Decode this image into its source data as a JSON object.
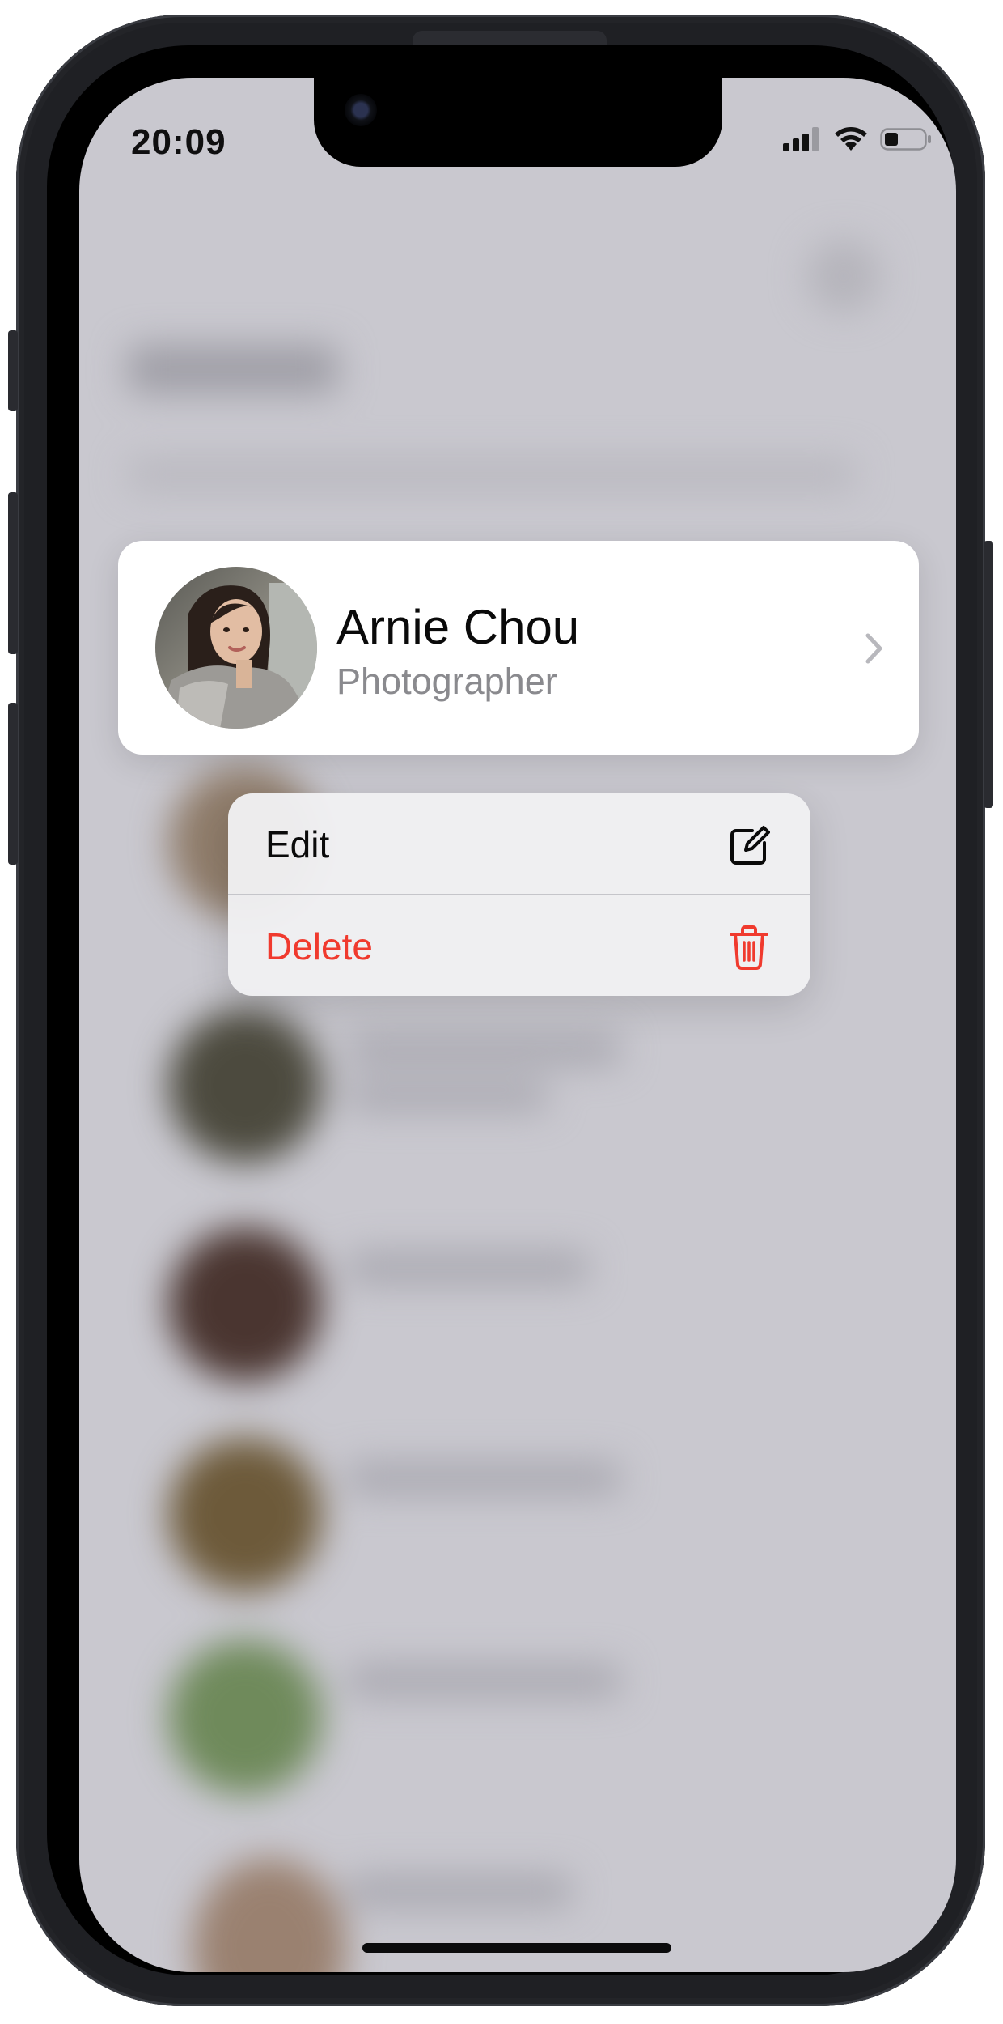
{
  "status_bar": {
    "time": "20:09"
  },
  "contact": {
    "name": "Arnie Chou",
    "role": "Photographer"
  },
  "context_menu": {
    "edit_label": "Edit",
    "delete_label": "Delete",
    "edit_icon": "compose-icon",
    "delete_icon": "trash-icon"
  },
  "colors": {
    "destructive": "#f03a2e",
    "primary_text": "#0a0a0a",
    "secondary_text": "#8a8a8e",
    "backdrop": "#c9c8cf"
  }
}
